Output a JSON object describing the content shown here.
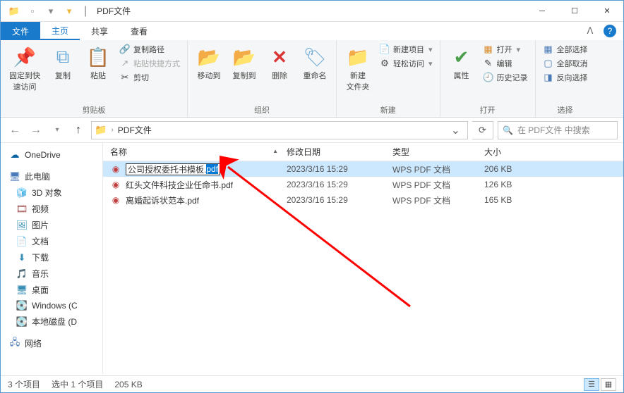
{
  "title": {
    "folder": "PDF文件"
  },
  "tabs": {
    "file": "文件",
    "home": "主页",
    "share": "共享",
    "view": "查看"
  },
  "ribbon": {
    "pin": {
      "label1": "固定到快",
      "label2": "速访问"
    },
    "copy": "复制",
    "paste": "粘贴",
    "copyPath": "复制路径",
    "pasteShortcut": "粘贴快捷方式",
    "cut": "剪切",
    "group_clipboard": "剪贴板",
    "moveTo": "移动到",
    "copyTo": "复制到",
    "delete": "删除",
    "rename": "重命名",
    "group_organize": "组织",
    "newFolder": {
      "label1": "新建",
      "label2": "文件夹"
    },
    "newItem": "新建项目",
    "easyAccess": "轻松访问",
    "group_new": "新建",
    "properties": "属性",
    "open": "打开",
    "edit": "编辑",
    "history": "历史记录",
    "group_open": "打开",
    "selectAll": "全部选择",
    "selectNone": "全部取消",
    "invertSel": "反向选择",
    "group_select": "选择"
  },
  "address": {
    "crumb": "PDF文件",
    "search_placeholder": "在 PDF文件 中搜索"
  },
  "sidebar": {
    "onedrive": "OneDrive",
    "thispc": "此电脑",
    "objects3d": "3D 对象",
    "videos": "视频",
    "pictures": "图片",
    "documents": "文档",
    "downloads": "下载",
    "music": "音乐",
    "desktop": "桌面",
    "windows": "Windows (C",
    "localdisk": "本地磁盘 (D",
    "network": "网络"
  },
  "columns": {
    "name": "名称",
    "date": "修改日期",
    "type": "类型",
    "size": "大小"
  },
  "files": [
    {
      "name_base": "公司授权委托书模板.",
      "name_sel": "pdf",
      "editing": true,
      "date": "2023/3/16 15:29",
      "type": "WPS PDF 文档",
      "size": "206 KB"
    },
    {
      "name": "红头文件科技企业任命书.pdf",
      "date": "2023/3/16 15:29",
      "type": "WPS PDF 文档",
      "size": "126 KB"
    },
    {
      "name": "离婚起诉状范本.pdf",
      "date": "2023/3/16 15:29",
      "type": "WPS PDF 文档",
      "size": "165 KB"
    }
  ],
  "status": {
    "count": "3 个项目",
    "selected": "选中 1 个项目",
    "sel_size": "205 KB"
  }
}
